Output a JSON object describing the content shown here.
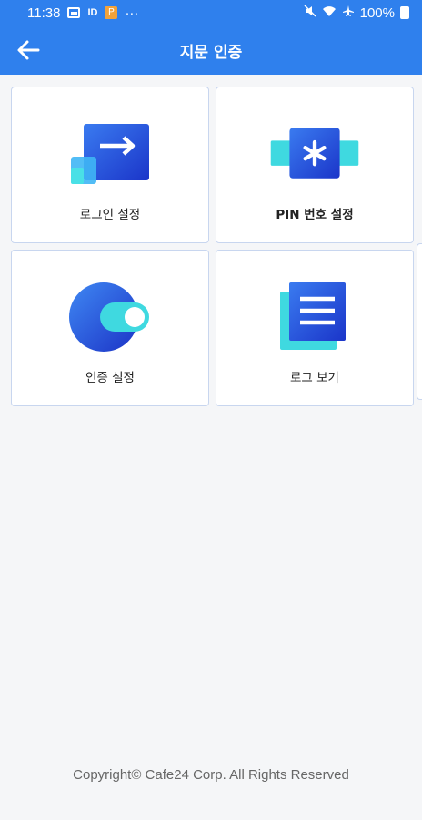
{
  "status_bar": {
    "time": "11:38",
    "dots": "···",
    "battery": "100%",
    "icons": [
      "image-icon",
      "tag-icon",
      "app-notification-icon",
      "mute-icon",
      "wifi-icon",
      "airplane-icon",
      "battery-icon"
    ]
  },
  "app_bar": {
    "title": "지문 인증",
    "back_icon": "arrow-left-icon"
  },
  "tiles": [
    {
      "label": "로그인 설정",
      "icon": "login-arrow-icon"
    },
    {
      "label": "PIN 번호 설정",
      "icon": "asterisk-pin-icon"
    },
    {
      "label": "인증 설정",
      "icon": "toggle-switch-icon"
    },
    {
      "label": "로그 보기",
      "icon": "document-list-icon"
    }
  ],
  "footer": {
    "copyright": "Copyright© Cafe24 Corp. All Rights Reserved"
  },
  "colors": {
    "primary": "#2f80ed",
    "tile_border": "#c8d6ef",
    "background": "#f5f6f8",
    "icon_dark_blue": "#2143d9",
    "icon_cyan": "#3fd9e0"
  }
}
